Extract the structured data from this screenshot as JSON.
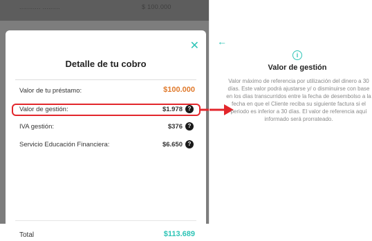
{
  "top_strip": {
    "left_text": "...........  .........",
    "right_text": "$ 100.000"
  },
  "sheet": {
    "title": "Detalle de tu cobro",
    "rows": [
      {
        "label": "Valor de tu préstamo:",
        "value": "$100.000"
      },
      {
        "label": "Valor de gestión:",
        "value": "$1.978"
      },
      {
        "label": "IVA gestión:",
        "value": "$376"
      },
      {
        "label": "Servicio Educación Financiera:",
        "value": "$6.650"
      }
    ],
    "total_label": "Total",
    "total_value": "$113.689",
    "info_icon_glyph": "?"
  },
  "detail": {
    "title": "Valor de gestión",
    "description": "Valor máximo de referencia por utilización del dinero a 30 días. Este valor podrá ajustarse y/ o disminuirse con base en los días transcurridos entre la fecha de desembolso a la fecha en que el Cliente reciba su siguiente factura si el periodo es inferior a 30 días. El valor de referencia aquí informado será prorrateado."
  },
  "colors": {
    "accent": "#2ec4b6",
    "loan_value": "#e07a2c",
    "highlight": "#e2262b",
    "backdrop": "#7d7d7d"
  },
  "icons": {
    "close": "close-icon",
    "back": "arrow-left-icon",
    "info": "info-icon",
    "help": "question-icon"
  }
}
